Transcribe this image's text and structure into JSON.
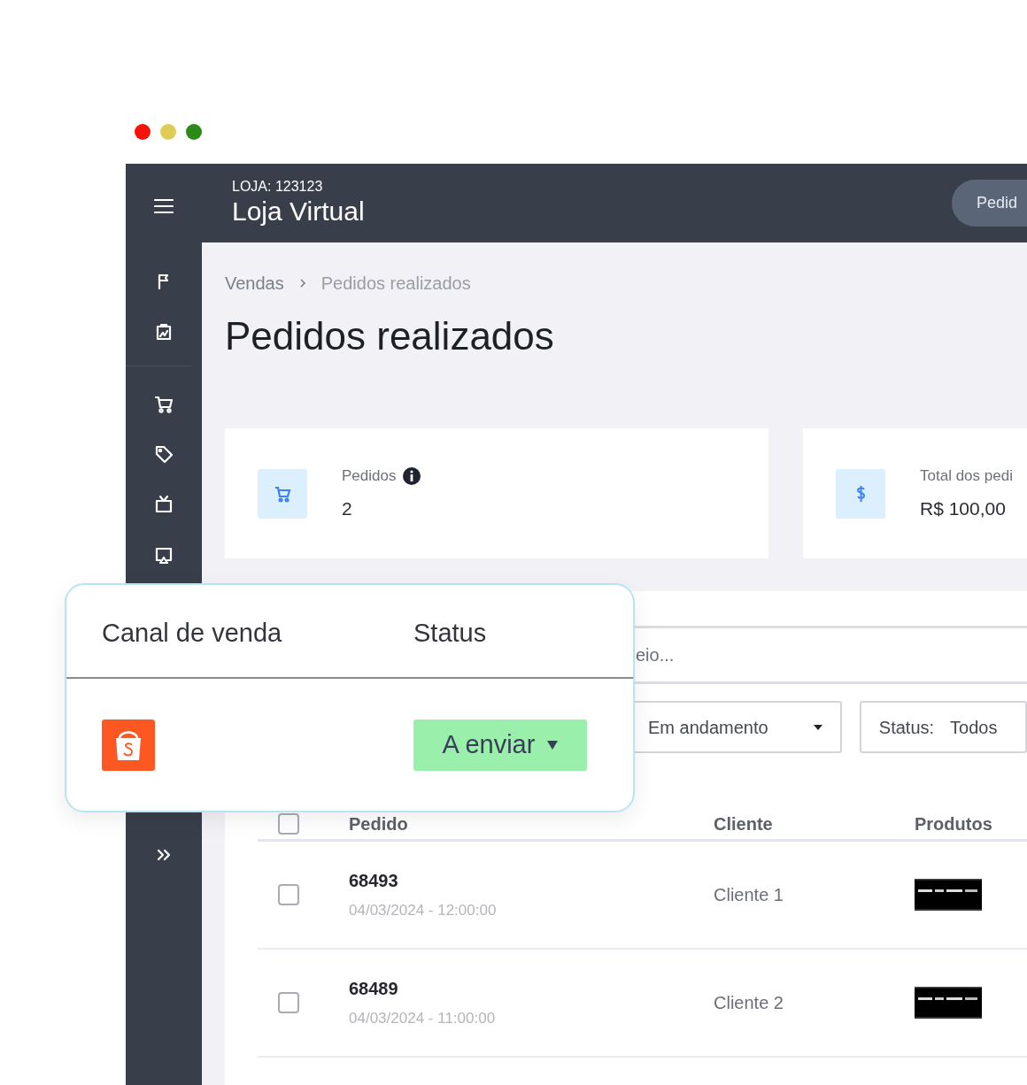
{
  "window_controls": [
    {
      "color": "#f5140a"
    },
    {
      "color": "#e1cb57"
    },
    {
      "color": "#2b8b16"
    }
  ],
  "header": {
    "store_label": "LOJA: 123123",
    "store_name": "Loja Virtual",
    "button": "Pedid"
  },
  "breadcrumb": [
    "Vendas",
    "Pedidos realizados"
  ],
  "title": "Pedidos realizados",
  "stats": [
    {
      "kind": "count",
      "label": "Pedidos",
      "value": "2",
      "info": true
    },
    {
      "kind": "money",
      "label": "Total dos pedi",
      "value": "R$ 100,00",
      "info": false
    }
  ],
  "search": {
    "placeholder": "eio..."
  },
  "filters": [
    {
      "kind": "dropdown",
      "value": "Em andamento"
    },
    {
      "kind": "labeled",
      "label": "Status:",
      "value": "Todos"
    }
  ],
  "table": {
    "columns": [
      "Pedido",
      "Cliente",
      "Produtos"
    ],
    "header_checked": false,
    "rows": [
      {
        "order": "68493",
        "date": "04/03/2024 - 12:00:00",
        "client": "Cliente 1",
        "checked": false
      },
      {
        "order": "68489",
        "date": "04/03/2024 - 11:00:00",
        "client": "Cliente 2",
        "checked": false
      }
    ]
  },
  "popup": {
    "columns": [
      "Canal de venda",
      "Status"
    ],
    "rows": [
      {
        "status": "A enviar"
      }
    ]
  }
}
